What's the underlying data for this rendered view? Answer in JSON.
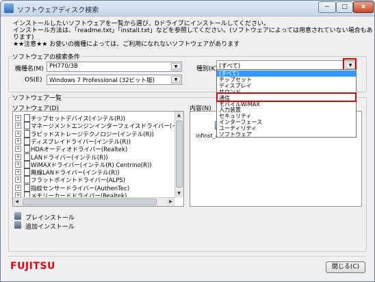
{
  "window": {
    "title": "ソフトウェアディスク検索",
    "minimize_glyph": "−",
    "maximize_glyph": "□",
    "close_glyph": "x"
  },
  "intro": {
    "line1": "インストールしたいソフトウェアを一覧から選び、Dドライブにインストールしてください。",
    "line2": "インストール方法は、「readme.txt」「install.txt」などを参照してください。(ソフトウェアによっては用意されていない場合もあります)",
    "line3": "★★注意★★ お使いの機種によっては、ご利用になれないソフトウェアがあります"
  },
  "search": {
    "legend": "ソフトウェアの検索条件",
    "model_label": "機種名(M)",
    "model_value": "PH770/3B",
    "os_label": "OS(E)",
    "os_value": "Windows 7 Professional (32ビット版)",
    "category_label": "種別(K)",
    "category_value": "(すべて)"
  },
  "software": {
    "legend": "ソフトウェア一覧",
    "list_label": "ソフトウェア(D)",
    "content_label": "内容(N)",
    "items": [
      "チップセットデバイス(インテル(R))",
      "マネージメントエンジンインターフェイスドライバー(インテル",
      "ラピッドストレージテクノロジー(インテル(R))",
      "ディスプレイドライバー(インテル(R))",
      "HDAオーディオドライバー(Realtek)",
      "LANドライバー(インテル(R))",
      "WiMAXドライバー(インテル(R) Centrino(R))",
      "無線LANドライバー(インテル(R))",
      "フラットポイントドライバー(ALPS)",
      "指紋センサードライバー(AuthenTec)",
      "メモリーカードドライバー(Realtek)"
    ],
    "file_name": "infinst_au"
  },
  "category_dropdown": {
    "options": [
      "(すべて)",
      "チップセット",
      "ディスプレイ",
      "サウンド",
      "通信",
      "モバイルWiMAX",
      "入力装置",
      "セキュリティ",
      "インターフェース",
      "ユーティリティ",
      "ソフトウェア"
    ],
    "selected_index": 0,
    "highlighted_index": 4
  },
  "actions": {
    "preinstall": "プレインストール",
    "add_install": "追加インストール"
  },
  "footer": {
    "logo": "FUJITSU",
    "close_button": "閉じる(C)"
  },
  "colors": {
    "highlight": "#e00000",
    "selection": "#3399ff",
    "logo": "#e60012"
  }
}
